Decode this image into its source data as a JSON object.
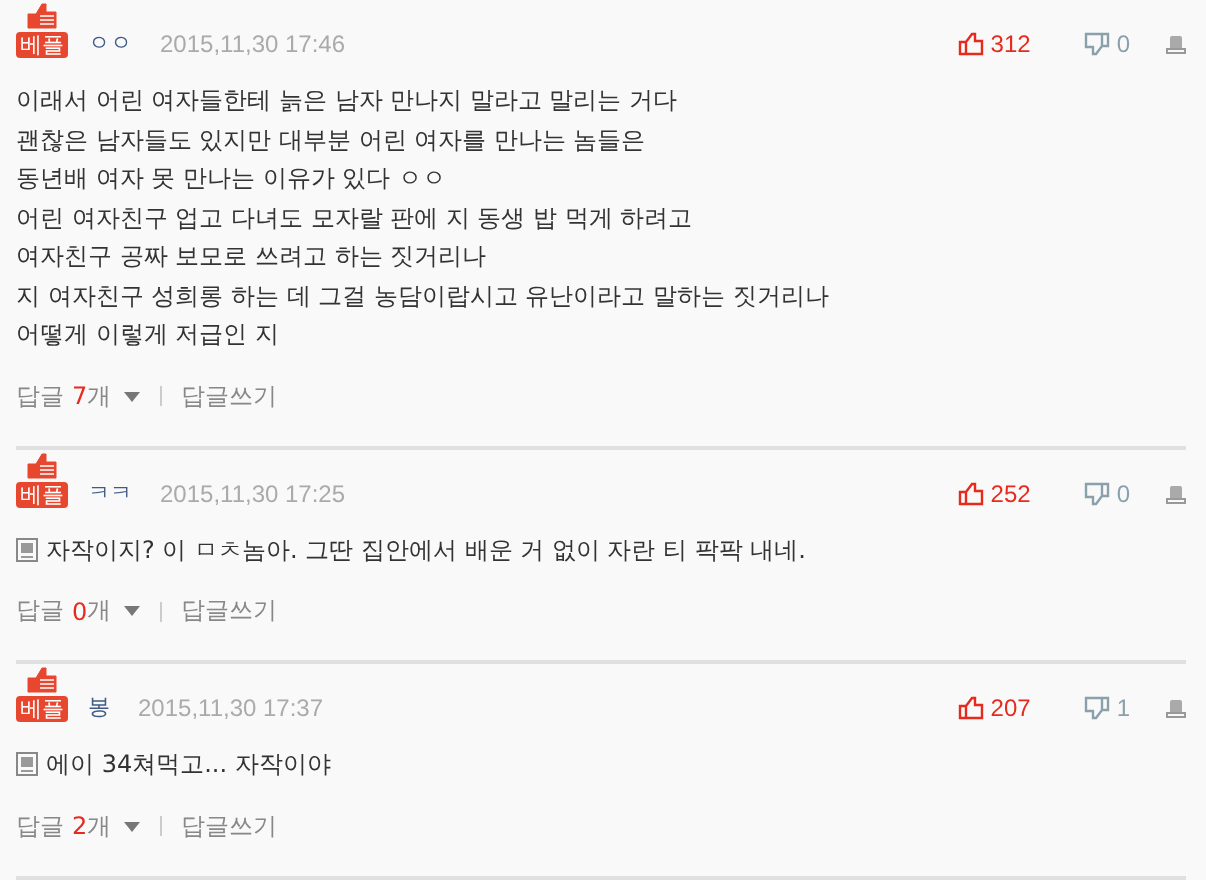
{
  "comments": [
    {
      "badge": "베플",
      "author": "ㅇㅇ",
      "date": "2015,11,30 17:46",
      "up": "312",
      "down": "0",
      "memo_icon": false,
      "lines": [
        "이래서 어린 여자들한테 늙은 남자 만나지 말라고 말리는 거다",
        "괜찮은 남자들도 있지만 대부분 어린 여자를 만나는 놈들은",
        "동년배 여자 못 만나는 이유가 있다 ㅇㅇ",
        "어린 여자친구 업고 다녀도 모자랄 판에 지 동생 밥 먹게 하려고",
        "여자친구 공짜 보모로 쓰려고 하는 짓거리나",
        "지 여자친구 성희롱 하는 데 그걸 농담이랍시고 유난이라고 말하는 짓거리나",
        "어떻게 이렇게 저급인 지"
      ],
      "reply_prefix": "답글",
      "reply_count": "7",
      "reply_suffix": "개",
      "write_reply": "답글쓰기"
    },
    {
      "badge": "베플",
      "author": "ㅋㅋ",
      "date": "2015,11,30 17:25",
      "up": "252",
      "down": "0",
      "memo_icon": true,
      "lines": [
        "자작이지? 이 ㅁㅊ놈아. 그딴 집안에서 배운 거 없이 자란 티 팍팍 내네."
      ],
      "reply_prefix": "답글",
      "reply_count": "0",
      "reply_suffix": "개",
      "write_reply": "답글쓰기"
    },
    {
      "badge": "베플",
      "author": "봉",
      "date": "2015,11,30 17:37",
      "up": "207",
      "down": "1",
      "memo_icon": true,
      "lines": [
        "에이 34쳐먹고... 자작이야"
      ],
      "reply_prefix": "답글",
      "reply_count": "2",
      "reply_suffix": "개",
      "write_reply": "답글쓰기"
    }
  ]
}
